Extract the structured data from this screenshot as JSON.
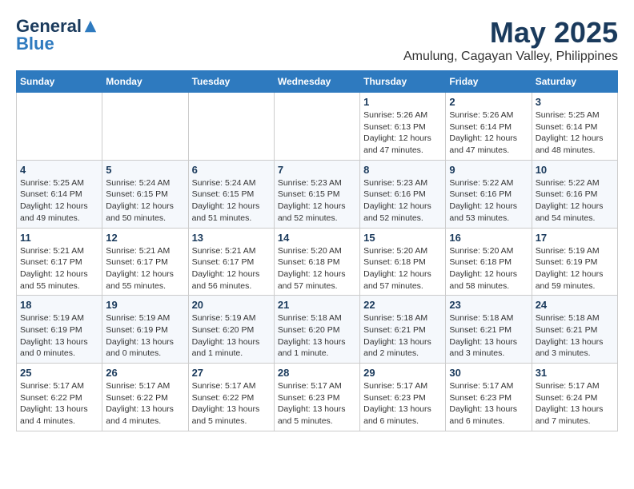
{
  "header": {
    "logo_general": "General",
    "logo_blue": "Blue",
    "month_title": "May 2025",
    "location": "Amulung, Cagayan Valley, Philippines"
  },
  "weekdays": [
    "Sunday",
    "Monday",
    "Tuesday",
    "Wednesday",
    "Thursday",
    "Friday",
    "Saturday"
  ],
  "weeks": [
    [
      {
        "day": "",
        "info": ""
      },
      {
        "day": "",
        "info": ""
      },
      {
        "day": "",
        "info": ""
      },
      {
        "day": "",
        "info": ""
      },
      {
        "day": "1",
        "info": "Sunrise: 5:26 AM\nSunset: 6:13 PM\nDaylight: 12 hours\nand 47 minutes."
      },
      {
        "day": "2",
        "info": "Sunrise: 5:26 AM\nSunset: 6:14 PM\nDaylight: 12 hours\nand 47 minutes."
      },
      {
        "day": "3",
        "info": "Sunrise: 5:25 AM\nSunset: 6:14 PM\nDaylight: 12 hours\nand 48 minutes."
      }
    ],
    [
      {
        "day": "4",
        "info": "Sunrise: 5:25 AM\nSunset: 6:14 PM\nDaylight: 12 hours\nand 49 minutes."
      },
      {
        "day": "5",
        "info": "Sunrise: 5:24 AM\nSunset: 6:15 PM\nDaylight: 12 hours\nand 50 minutes."
      },
      {
        "day": "6",
        "info": "Sunrise: 5:24 AM\nSunset: 6:15 PM\nDaylight: 12 hours\nand 51 minutes."
      },
      {
        "day": "7",
        "info": "Sunrise: 5:23 AM\nSunset: 6:15 PM\nDaylight: 12 hours\nand 52 minutes."
      },
      {
        "day": "8",
        "info": "Sunrise: 5:23 AM\nSunset: 6:16 PM\nDaylight: 12 hours\nand 52 minutes."
      },
      {
        "day": "9",
        "info": "Sunrise: 5:22 AM\nSunset: 6:16 PM\nDaylight: 12 hours\nand 53 minutes."
      },
      {
        "day": "10",
        "info": "Sunrise: 5:22 AM\nSunset: 6:16 PM\nDaylight: 12 hours\nand 54 minutes."
      }
    ],
    [
      {
        "day": "11",
        "info": "Sunrise: 5:21 AM\nSunset: 6:17 PM\nDaylight: 12 hours\nand 55 minutes."
      },
      {
        "day": "12",
        "info": "Sunrise: 5:21 AM\nSunset: 6:17 PM\nDaylight: 12 hours\nand 55 minutes."
      },
      {
        "day": "13",
        "info": "Sunrise: 5:21 AM\nSunset: 6:17 PM\nDaylight: 12 hours\nand 56 minutes."
      },
      {
        "day": "14",
        "info": "Sunrise: 5:20 AM\nSunset: 6:18 PM\nDaylight: 12 hours\nand 57 minutes."
      },
      {
        "day": "15",
        "info": "Sunrise: 5:20 AM\nSunset: 6:18 PM\nDaylight: 12 hours\nand 57 minutes."
      },
      {
        "day": "16",
        "info": "Sunrise: 5:20 AM\nSunset: 6:18 PM\nDaylight: 12 hours\nand 58 minutes."
      },
      {
        "day": "17",
        "info": "Sunrise: 5:19 AM\nSunset: 6:19 PM\nDaylight: 12 hours\nand 59 minutes."
      }
    ],
    [
      {
        "day": "18",
        "info": "Sunrise: 5:19 AM\nSunset: 6:19 PM\nDaylight: 13 hours\nand 0 minutes."
      },
      {
        "day": "19",
        "info": "Sunrise: 5:19 AM\nSunset: 6:19 PM\nDaylight: 13 hours\nand 0 minutes."
      },
      {
        "day": "20",
        "info": "Sunrise: 5:19 AM\nSunset: 6:20 PM\nDaylight: 13 hours\nand 1 minute."
      },
      {
        "day": "21",
        "info": "Sunrise: 5:18 AM\nSunset: 6:20 PM\nDaylight: 13 hours\nand 1 minute."
      },
      {
        "day": "22",
        "info": "Sunrise: 5:18 AM\nSunset: 6:21 PM\nDaylight: 13 hours\nand 2 minutes."
      },
      {
        "day": "23",
        "info": "Sunrise: 5:18 AM\nSunset: 6:21 PM\nDaylight: 13 hours\nand 3 minutes."
      },
      {
        "day": "24",
        "info": "Sunrise: 5:18 AM\nSunset: 6:21 PM\nDaylight: 13 hours\nand 3 minutes."
      }
    ],
    [
      {
        "day": "25",
        "info": "Sunrise: 5:17 AM\nSunset: 6:22 PM\nDaylight: 13 hours\nand 4 minutes."
      },
      {
        "day": "26",
        "info": "Sunrise: 5:17 AM\nSunset: 6:22 PM\nDaylight: 13 hours\nand 4 minutes."
      },
      {
        "day": "27",
        "info": "Sunrise: 5:17 AM\nSunset: 6:22 PM\nDaylight: 13 hours\nand 5 minutes."
      },
      {
        "day": "28",
        "info": "Sunrise: 5:17 AM\nSunset: 6:23 PM\nDaylight: 13 hours\nand 5 minutes."
      },
      {
        "day": "29",
        "info": "Sunrise: 5:17 AM\nSunset: 6:23 PM\nDaylight: 13 hours\nand 6 minutes."
      },
      {
        "day": "30",
        "info": "Sunrise: 5:17 AM\nSunset: 6:23 PM\nDaylight: 13 hours\nand 6 minutes."
      },
      {
        "day": "31",
        "info": "Sunrise: 5:17 AM\nSunset: 6:24 PM\nDaylight: 13 hours\nand 7 minutes."
      }
    ]
  ]
}
